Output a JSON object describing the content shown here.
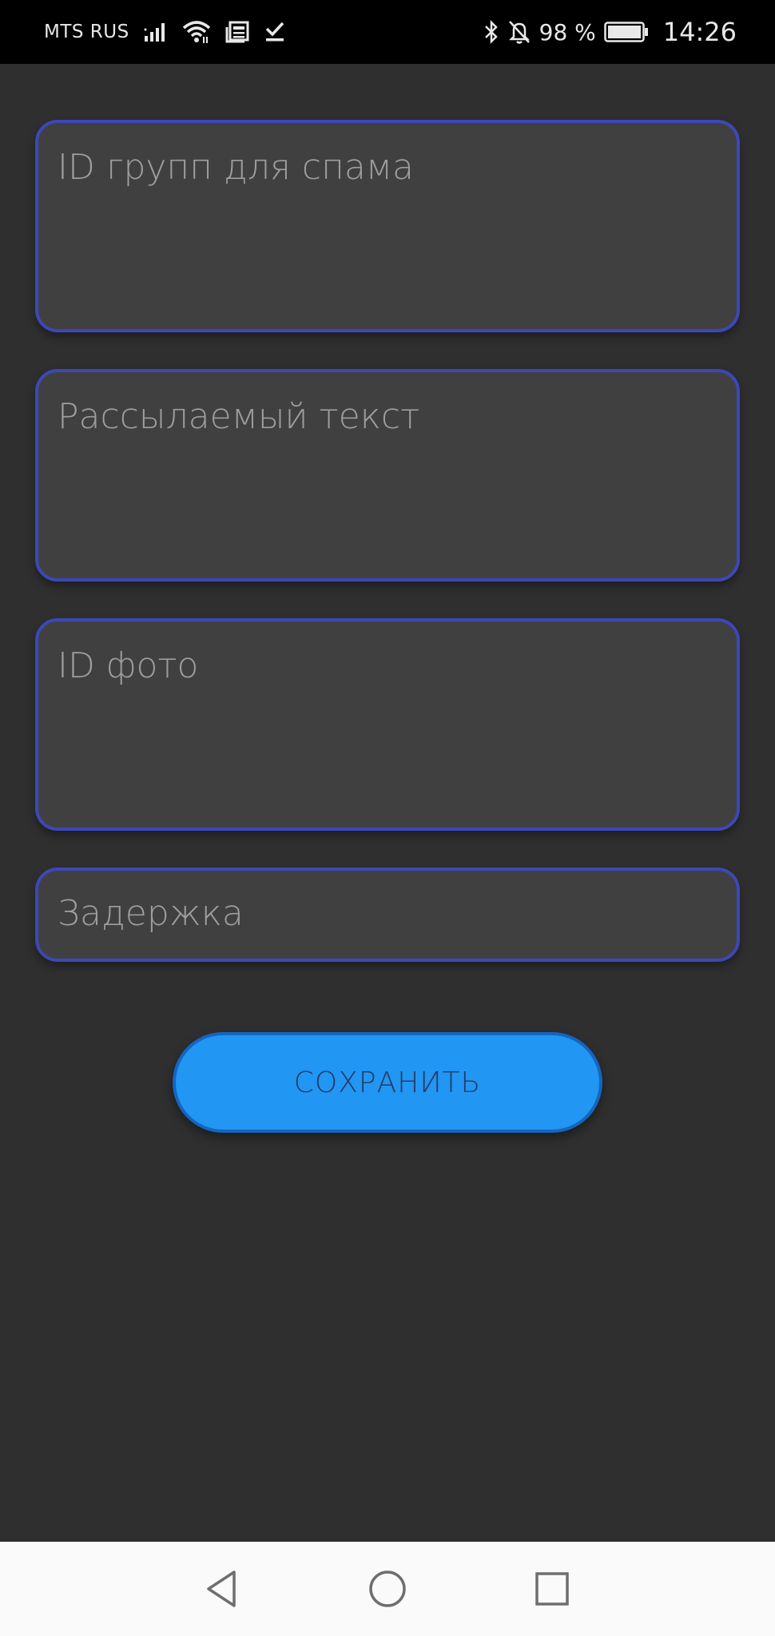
{
  "status_bar": {
    "carrier": "MTS RUS",
    "battery_percent": "98 %",
    "time": "14:26",
    "icons": [
      "signal-icon",
      "wifi-icon",
      "news-icon",
      "download-done-icon",
      "bluetooth-icon",
      "notifications-off-icon",
      "battery-icon"
    ]
  },
  "form": {
    "group_ids_placeholder": "ID групп для спама",
    "message_text_placeholder": "Рассылаемый текст",
    "photo_id_placeholder": "ID фото",
    "delay_placeholder": "Задержка",
    "group_ids_value": "",
    "message_text_value": "",
    "photo_id_value": "",
    "delay_value": ""
  },
  "actions": {
    "save_label": "СОХРАНИТЬ"
  },
  "colors": {
    "background": "#2f2f2f",
    "field_background": "#414041",
    "field_border": "#3c48b8",
    "button": "#2196f3",
    "button_text": "#243a63",
    "status_bar": "#000000",
    "nav_bar": "#fafafa"
  },
  "nav_bar": {
    "icons": [
      "back-icon",
      "home-icon",
      "recent-apps-icon"
    ]
  }
}
